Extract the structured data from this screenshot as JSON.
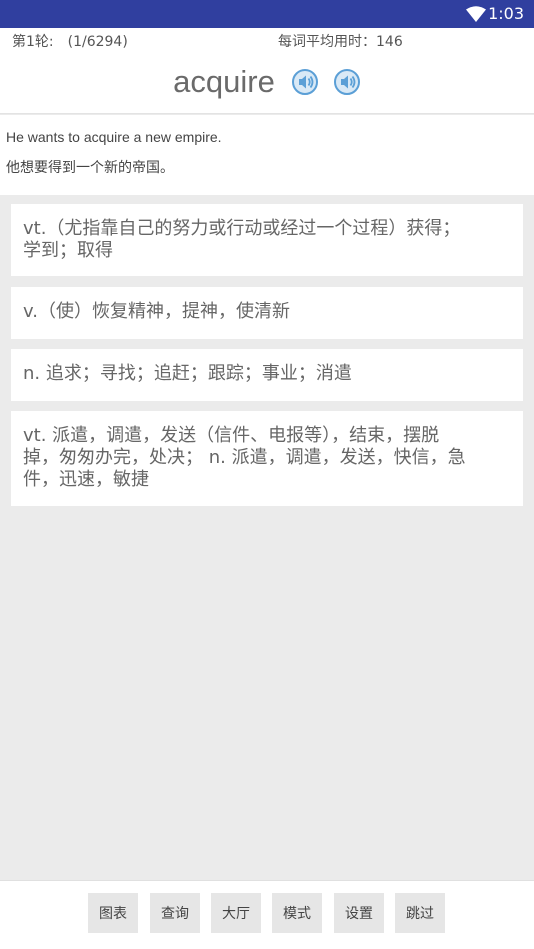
{
  "status_bar": {
    "time": "1:03"
  },
  "header": {
    "round_info": "第1轮:　(1/6294)",
    "avg_time": "每词平均用时：146",
    "word": "acquire"
  },
  "example": {
    "en": "He wants to acquire a new empire.",
    "zh": "他想要得到一个新的帝国。"
  },
  "options": [
    {
      "text": "vt.（尤指靠自己的努力或行动或经过一个过程）获得；学到；取得"
    },
    {
      "text": "v.（使）恢复精神，提神，使清新"
    },
    {
      "text": "n. 追求；寻找；追赶；跟踪；事业；消遣"
    },
    {
      "text": "vt. 派遣，调遣，发送（信件、电报等），结束，摆脱掉，匆匆办完，处决；  n. 派遣，调遣，发送，快信，急件，迅速，敏捷"
    }
  ],
  "bottom_bar": {
    "chart": "图表",
    "lookup": "查询",
    "hall": "大厅",
    "mode": "模式",
    "settings": "设置",
    "skip": "跳过"
  },
  "colors": {
    "status_bar": "#303f9f",
    "background": "#ebebeb",
    "speaker": "#5b9fd6"
  }
}
